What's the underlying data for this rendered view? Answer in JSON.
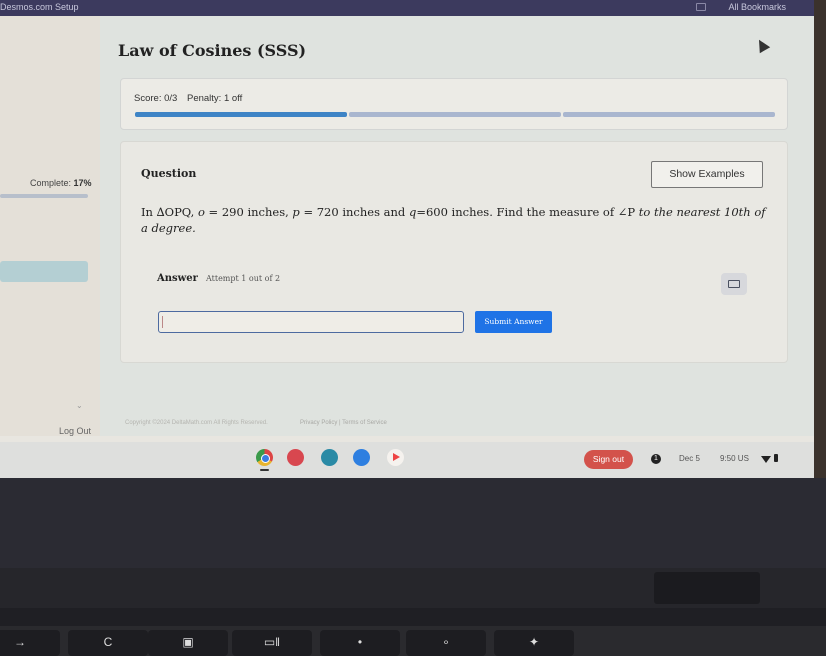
{
  "browser": {
    "bookmark_left": "Desmos.com Setup",
    "bookmark_right": "All Bookmarks"
  },
  "sidebar": {
    "complete_label": "Complete:",
    "complete_value": "17%",
    "complete_fraction": 0.17,
    "chevron": "⌄",
    "logout_label": "Log Out"
  },
  "page": {
    "title": "Law of Cosines (SSS)"
  },
  "score": {
    "score_label": "Score: 0/3",
    "penalty_label": "Penalty: 1 off",
    "progress_segments_total": 3,
    "progress_segments_filled": 1,
    "colors": {
      "filled": "#3e84c6",
      "empty": "#a9b6cf"
    }
  },
  "question": {
    "heading": "Question",
    "show_examples_label": "Show Examples",
    "text_part1": "In ∆OPQ, ",
    "o_var": "o",
    "text_part2": " = 290 inches, ",
    "p_var": "p",
    "text_part3": " = 720 inches and ",
    "q_var": "q",
    "text_part4": "=600 inches. Find the measure of ∠P ",
    "text_italic": "to the nearest 10th of a degree."
  },
  "answer": {
    "label": "Answer",
    "attempt_label": "Attempt 1 out of 2",
    "input_value": "",
    "submit_label": "Submit Answer",
    "submit_color": "#1f73e6"
  },
  "footer": {
    "copyright": "Copyright ©2024 DeltaMath.com All Rights Reserved.",
    "links": "Privacy Policy | Terms of Service"
  },
  "shelf": {
    "apps": [
      "chrome",
      "art-app",
      "classroom",
      "files",
      "play-store"
    ],
    "sign_out_label": "Sign out",
    "notification_count": "1",
    "date": "Dec 5",
    "time": "9:50 US"
  },
  "keyboard": {
    "keys": [
      "→",
      "C",
      "▣",
      "▭‖",
      "•",
      "∘",
      "✦"
    ]
  }
}
